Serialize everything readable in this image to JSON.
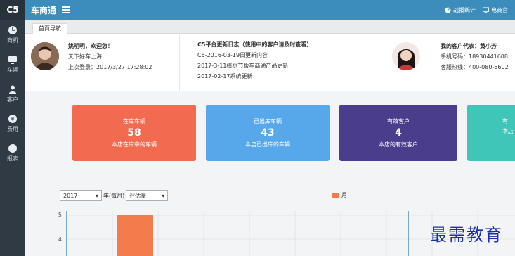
{
  "sidebar": {
    "brand": "C5",
    "items": [
      {
        "label": "商机",
        "icon": "clock-icon"
      },
      {
        "label": "车辆",
        "icon": "monitor-icon"
      },
      {
        "label": "客户",
        "icon": "user-icon"
      },
      {
        "label": "费用",
        "icon": "yen-icon"
      },
      {
        "label": "报表",
        "icon": "pie-chart-icon"
      }
    ]
  },
  "topbar": {
    "title": "车商通",
    "links": [
      {
        "label": "战报统计",
        "icon": "dashboard-icon"
      },
      {
        "label": "电商官",
        "icon": "monitor-icon"
      }
    ]
  },
  "tabs": [
    "首页导航"
  ],
  "welcome": {
    "greeting": "姚明明，欢迎您！",
    "location": "天下好车上海",
    "last_login": "上次登录：2017/3/27 17:28:02"
  },
  "news": {
    "title": "C5平台更新日志（使用中的客户请及时查看）",
    "items": [
      "C5-2016-03-19日更新内容",
      "2017-3-11植树节版车商通产品更新",
      "2017-02-17系统更新"
    ]
  },
  "rep": {
    "title": "我的客户代表：黄小芳",
    "phone": "手机号码：18930441608",
    "hotline": "客服热线：400-080-6602"
  },
  "cards": [
    {
      "title": "在库车辆",
      "value": "58",
      "sub": "本店在库中的车辆",
      "color": "#f26b50"
    },
    {
      "title": "已出库车辆",
      "value": "43",
      "sub": "本店已出库的车辆",
      "color": "#56a8ea"
    },
    {
      "title": "有效客户",
      "value": "4",
      "sub": "本店的有效客户",
      "color": "#4a3d8c"
    },
    {
      "title": "有",
      "value": "",
      "sub": "本店",
      "color": "#3fc6b8"
    }
  ],
  "chart_controls": {
    "year": "2017",
    "period_label": "年(每月)",
    "metric": "评估量"
  },
  "chart_data": {
    "type": "bar",
    "series": [
      {
        "name": "月",
        "color": "#f47b4b"
      }
    ],
    "y_ticks_visible": [
      "5",
      "4"
    ]
  },
  "watermark": "最需教育"
}
